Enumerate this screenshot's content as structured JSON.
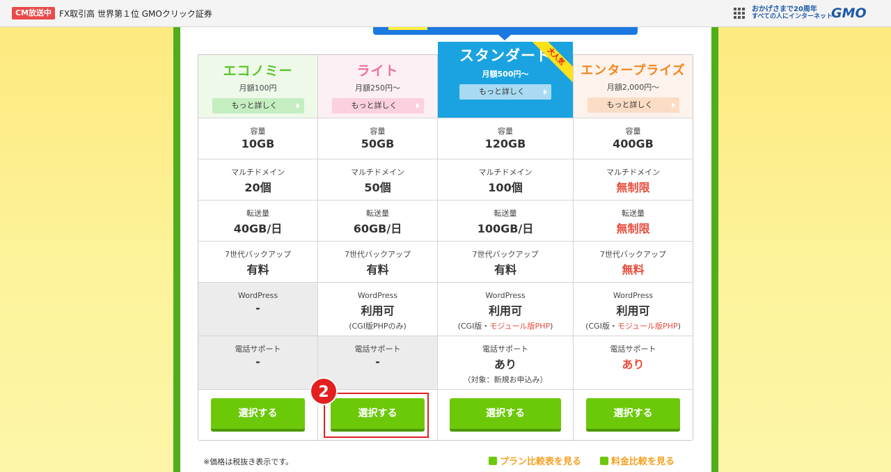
{
  "topbar": {
    "badge": "CM放送中",
    "text": "FX取引高 世界第１位 GMOクリック証券",
    "slogan_line1": "おかげさまで20周年",
    "slogan_line2": "すべての人にインターネット",
    "logo": "GMO"
  },
  "plans": [
    {
      "name": "エコノミー",
      "price": "月額100円",
      "more": "もっと詳しく",
      "color": "#5cc42b",
      "head_bg": "#eef9ea",
      "btn_bg": "#c5eec0",
      "capacity_label": "容量",
      "capacity": "10GB",
      "domain_label": "マルチドメイン",
      "domain": "20個",
      "transfer_label": "転送量",
      "transfer": "40GB/日",
      "backup_label": "7世代バックアップ",
      "backup": "有料",
      "wp_label": "WordPress",
      "wp": "-",
      "phone_label": "電話サポート",
      "phone": "-",
      "select": "選択する"
    },
    {
      "name": "ライト",
      "price": "月額250円〜",
      "more": "もっと詳しく",
      "color": "#ee6f9e",
      "head_bg": "#fdf0f5",
      "btn_bg": "#fbd0df",
      "capacity_label": "容量",
      "capacity": "50GB",
      "domain_label": "マルチドメイン",
      "domain": "50個",
      "transfer_label": "転送量",
      "transfer": "60GB/日",
      "backup_label": "7世代バックアップ",
      "backup": "有料",
      "wp_label": "WordPress",
      "wp": "利用可",
      "wp_note": "(CGI版PHPのみ)",
      "phone_label": "電話サポート",
      "phone": "-",
      "select": "選択する"
    },
    {
      "name": "スタンダード",
      "price": "月額500円〜",
      "more": "もっと詳しく",
      "color": "#ffffff",
      "head_bg": "#1aa3e0",
      "btn_bg": "#a8dbf3",
      "popular": "大人気",
      "capacity_label": "容量",
      "capacity": "120GB",
      "domain_label": "マルチドメイン",
      "domain": "100個",
      "transfer_label": "転送量",
      "transfer": "100GB/日",
      "backup_label": "7世代バックアップ",
      "backup": "有料",
      "wp_label": "WordPress",
      "wp": "利用可",
      "wp_note_a": "(CGI版・",
      "wp_note_b": "モジュール版PHP",
      "wp_note_c": ")",
      "phone_label": "電話サポート",
      "phone": "あり",
      "phone_note": "（対象：新規お申込み）",
      "select": "選択する"
    },
    {
      "name": "エンタープライズ",
      "price": "月額2,000円〜",
      "more": "もっと詳しく",
      "color": "#f5841f",
      "head_bg": "#fdf3ec",
      "btn_bg": "#fbdcc4",
      "capacity_label": "容量",
      "capacity": "400GB",
      "domain_label": "マルチドメイン",
      "domain": "無制限",
      "transfer_label": "転送量",
      "transfer": "無制限",
      "backup_label": "7世代バックアップ",
      "backup": "無料",
      "wp_label": "WordPress",
      "wp": "利用可",
      "wp_note_a": "(CGI版・",
      "wp_note_b": "モジュール版PHP",
      "wp_note_c": ")",
      "phone_label": "電話サポート",
      "phone": "あり",
      "select": "選択する"
    }
  ],
  "callout_number": "2",
  "footer": {
    "note": "※価格は税抜き表示です。",
    "link1": "プラン比較表を見る",
    "link2": "料金比較を見る"
  }
}
